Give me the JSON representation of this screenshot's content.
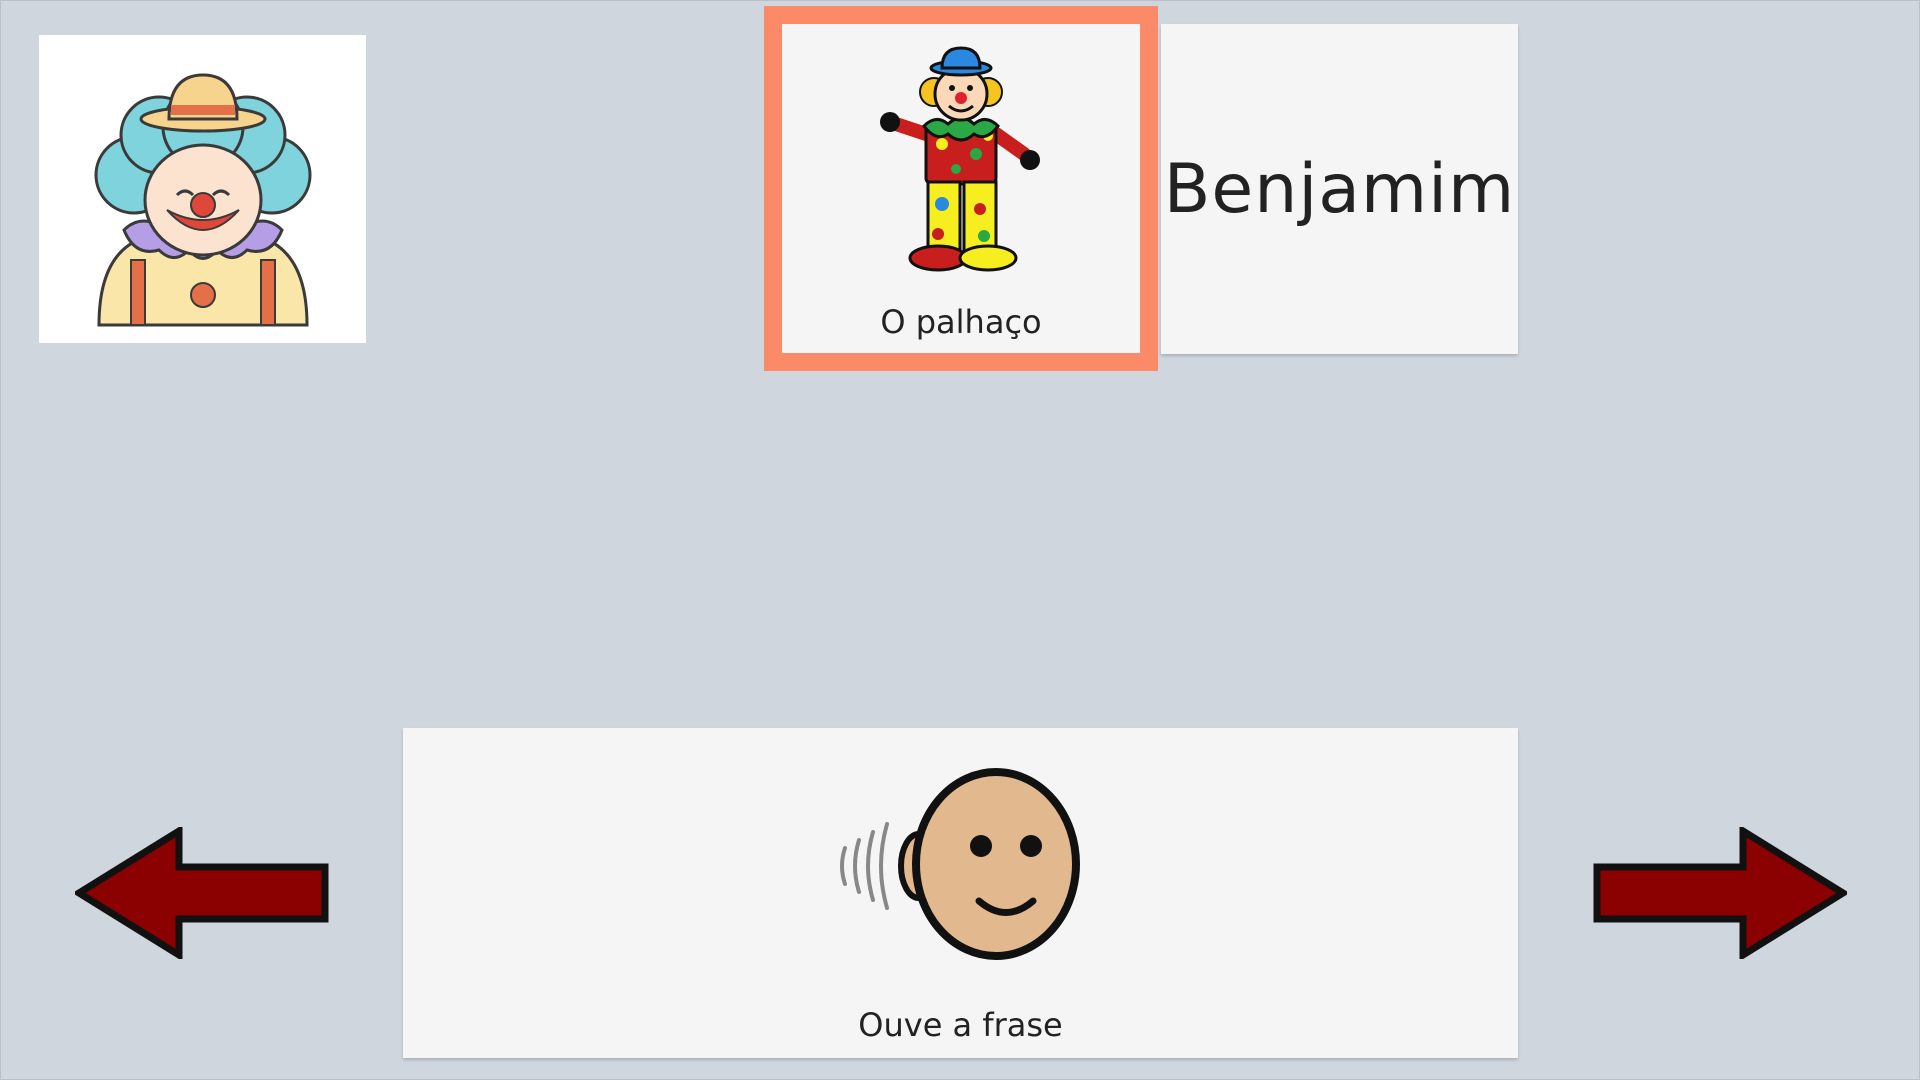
{
  "reference_image": {
    "icon": "clown-head-icon"
  },
  "selected_card": {
    "label": "O palhaço",
    "icon": "clown-icon",
    "highlight_color": "#fb8a69"
  },
  "name_card": {
    "text": "Benjamim"
  },
  "listen_card": {
    "label": "Ouve a frase",
    "icon": "listen-ear-icon"
  },
  "navigation": {
    "previous_icon": "arrow-left-icon",
    "next_icon": "arrow-right-icon",
    "arrow_color": "#8b0000"
  },
  "colors": {
    "background": "#cfd6de",
    "card_background": "#f5f5f5"
  }
}
